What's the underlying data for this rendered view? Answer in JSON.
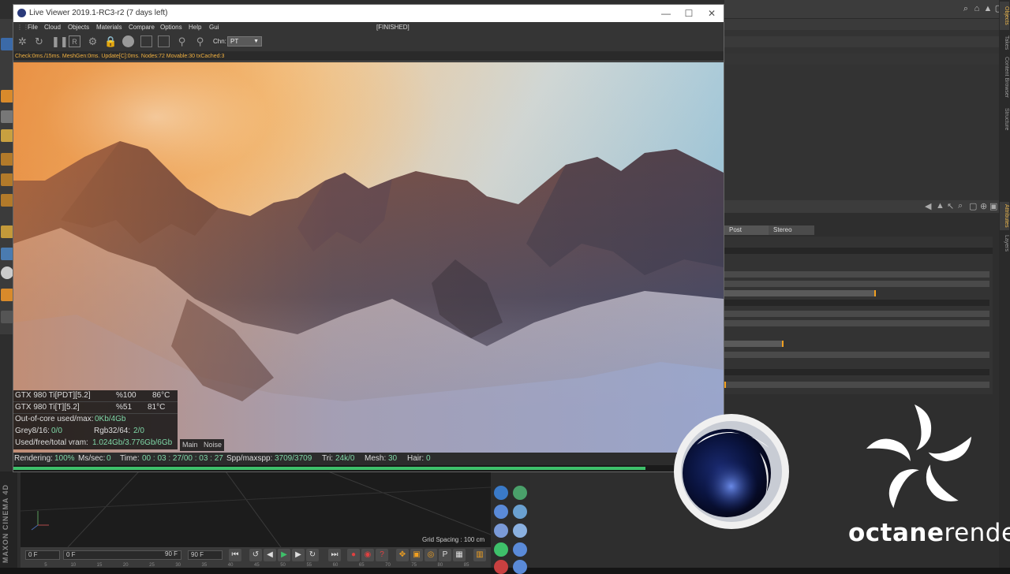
{
  "window": {
    "title": "Live Viewer 2019.1-RC3-r2 (7 days left)",
    "status": "[FINISHED]",
    "controls": {
      "minimize": "—",
      "maximize": "☐",
      "close": "✕"
    }
  },
  "menu": [
    "File",
    "Cloud",
    "Objects",
    "Materials",
    "Compare",
    "Options",
    "Help",
    "Gui"
  ],
  "toolbar": {
    "channel_label": "Chn:",
    "channel_value": "PT"
  },
  "info_line": "Check:0ms./15ms. MeshGen:0ms. Update[C]:0ms. Nodes:72 Movable:30 txCached:3",
  "gpus": [
    {
      "name": "GTX 980 Ti[PDT][5.2]",
      "usage": "%100",
      "temp": "86°C"
    },
    {
      "name": "GTX 980 Ti[T][5.2]",
      "usage": "%51",
      "temp": "81°C"
    }
  ],
  "stats": {
    "out_of_core_label": "Out-of-core used/max:",
    "out_of_core_value": "0Kb/4Gb",
    "grey_label": "Grey8/16:",
    "grey_value": "0/0",
    "rgb_label": "Rgb32/64:",
    "rgb_value": "2/0",
    "vram_label": "Used/free/total vram:",
    "vram_value": "1.024Gb/3.776Gb/6Gb"
  },
  "view_tabs": [
    "Main",
    "Noise"
  ],
  "bottom_status": {
    "rendering_label": "Rendering:",
    "rendering_value": "100%",
    "ms_label": "Ms/sec:",
    "ms_value": "0",
    "time_label": "Time:",
    "time_value": "00 : 03 : 27/00 : 03 : 27",
    "spp_label": "Spp/maxspp:",
    "spp_value": "3709/3709",
    "tri_label": "Tri:",
    "tri_value": "24k/0",
    "mesh_label": "Mesh:",
    "mesh_value": "30",
    "hair_label": "Hair:",
    "hair_value": "0"
  },
  "progress_fraction": 0.89,
  "attributes_tabs": [
    "Post processing",
    "Stereo"
  ],
  "right_tabs": [
    "Objects",
    "Takes",
    "Content Browser",
    "Structure",
    "Attributes",
    "Layers"
  ],
  "viewport": {
    "grid_spacing": "Grid Spacing : 100 cm"
  },
  "timeline": {
    "start_frame": "0 F",
    "current_frame": "0 F",
    "end_frame": "90 F",
    "end_frame_field": "90 F",
    "ruler": [
      "5",
      "10",
      "15",
      "20",
      "25",
      "30",
      "35",
      "40",
      "45",
      "50",
      "55",
      "60",
      "65",
      "70",
      "75",
      "80",
      "85"
    ]
  },
  "brand": {
    "maxon": "MAXON CINEMA 4D",
    "octane_prefix": "octane",
    "octane_suffix": "render"
  },
  "colors": {
    "accent_orange": "#f1a020",
    "info_text": "#f0b040",
    "stat_highlight": "#7fd7a7",
    "progress": "#3ec06a"
  }
}
